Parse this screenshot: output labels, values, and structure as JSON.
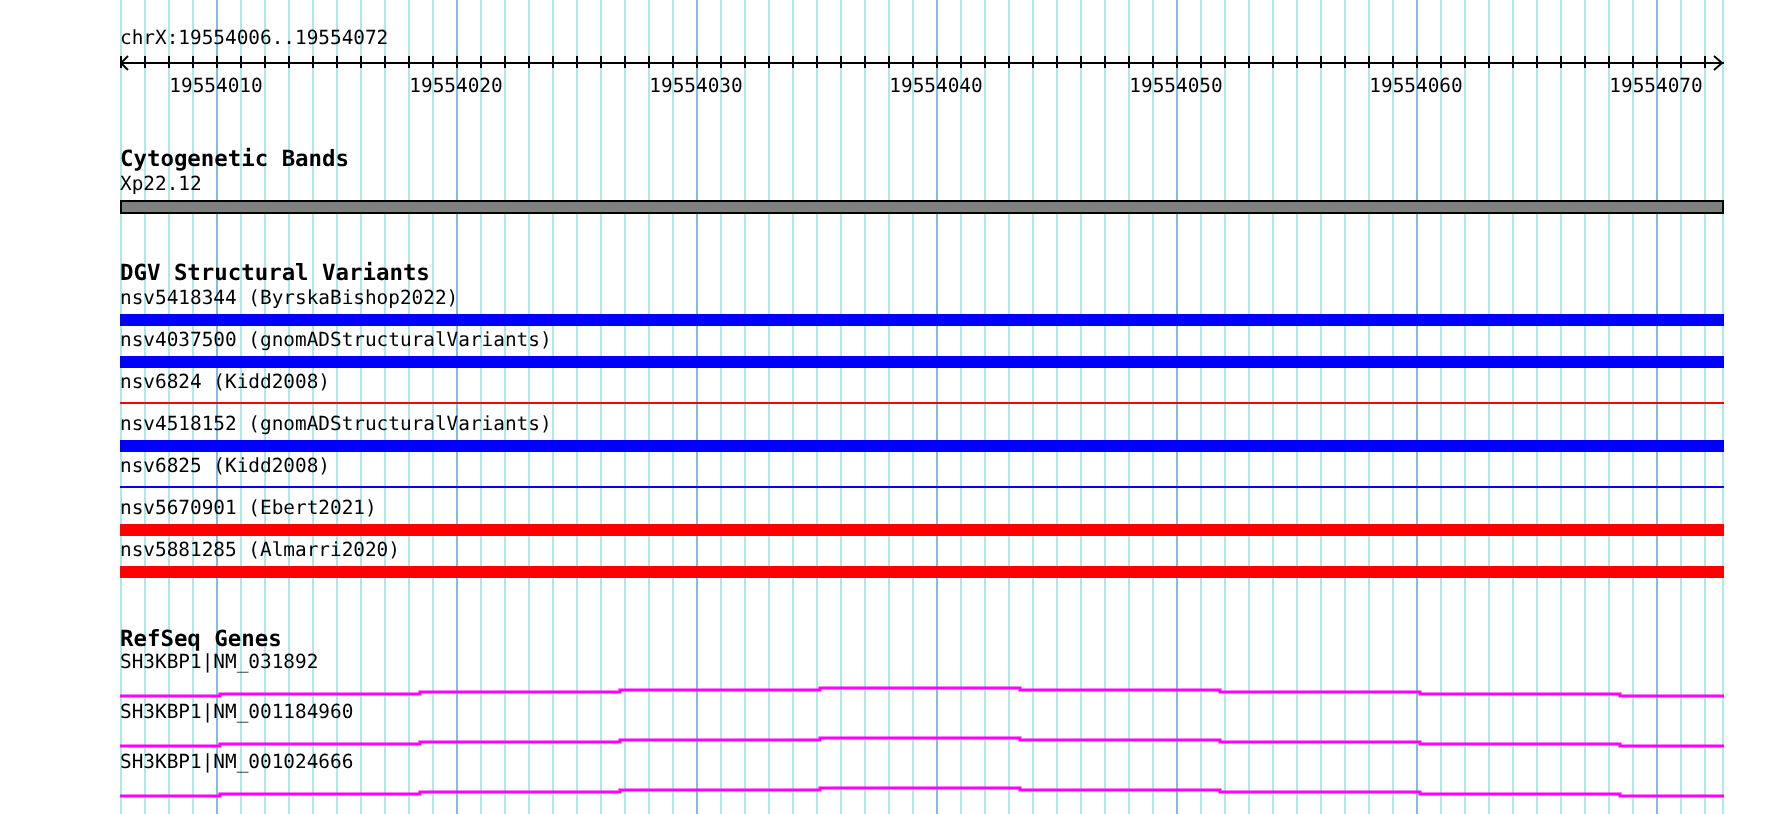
{
  "ruler": {
    "location": "chrX:19554006..19554072",
    "ticks": [
      "19554010",
      "19554020",
      "19554030",
      "19554040",
      "19554050",
      "19554060",
      "19554070"
    ]
  },
  "tracks": [
    {
      "title": "Cytogenetic Bands",
      "features": [
        {
          "kind": "band",
          "label": "Xp22.12",
          "color": "#808080"
        }
      ]
    },
    {
      "title": "DGV Structural Variants",
      "features": [
        {
          "kind": "bar",
          "label": "nsv5418344 (ByrskaBishop2022)",
          "color": "#0000ff"
        },
        {
          "kind": "bar",
          "label": "nsv4037500 (gnomADStructuralVariants)",
          "color": "#0000ff"
        },
        {
          "kind": "line",
          "label": "nsv6824 (Kidd2008)",
          "color": "#ff0000"
        },
        {
          "kind": "bar",
          "label": "nsv4518152 (gnomADStructuralVariants)",
          "color": "#0000ff"
        },
        {
          "kind": "line",
          "label": "nsv6825 (Kidd2008)",
          "color": "#0000ff"
        },
        {
          "kind": "bar",
          "label": "nsv5670901 (Ebert2021)",
          "color": "#ff0000"
        },
        {
          "kind": "bar",
          "label": "nsv5881285 (Almarri2020)",
          "color": "#ff0000"
        }
      ]
    },
    {
      "title": "RefSeq Genes",
      "features": [
        {
          "kind": "gene",
          "label": "SH3KBP1|NM_031892",
          "color": "#ff00ff"
        },
        {
          "kind": "gene",
          "label": "SH3KBP1|NM_001184960",
          "color": "#ff00ff"
        },
        {
          "kind": "gene",
          "label": "SH3KBP1|NM_001024666",
          "color": "#ff00ff"
        }
      ]
    }
  ]
}
